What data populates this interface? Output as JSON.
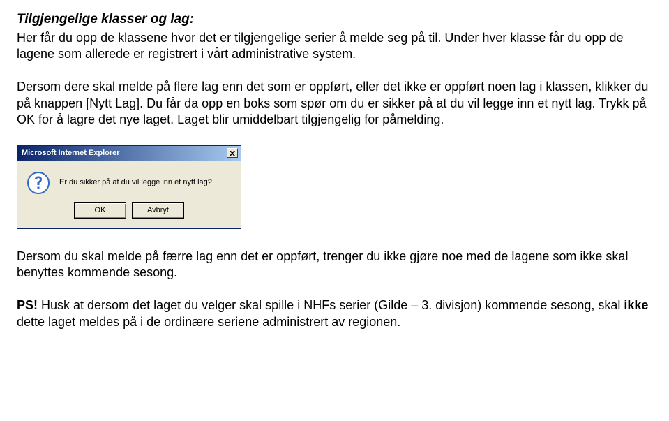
{
  "heading": "Tilgjengelige klasser og lag:",
  "intro_p1": "Her får du opp de klassene hvor det er tilgjengelige serier å melde seg på til. Under hver klasse får du opp de lagene som allerede er registrert i vårt administrative system.",
  "intro_p2": "Dersom dere skal melde på flere lag enn det som er oppført, eller det ikke er oppført noen lag i klassen, klikker du på knappen [Nytt Lag]. Du får da opp en boks som spør om du er sikker på at du vil legge inn et nytt lag. Trykk på OK for å lagre det nye laget. Laget blir umiddelbart tilgjengelig for påmelding.",
  "dialog": {
    "title": "Microsoft Internet Explorer",
    "message": "Er du sikker på at du vil legge inn et nytt lag?",
    "ok": "OK",
    "cancel": "Avbryt"
  },
  "outro_p1": "Dersom du skal melde på færre lag enn det er oppført, trenger du ikke gjøre noe med de lagene som ikke skal benyttes kommende sesong.",
  "outro_ps_prefix": "PS!",
  "outro_ps_part1": " Husk at dersom det laget du velger skal spille i NHFs serier (Gilde – 3. divisjon) kommende sesong, skal ",
  "outro_ps_bold": "ikke",
  "outro_ps_part2": " dette laget meldes på i de ordinære seriene administrert av regionen."
}
